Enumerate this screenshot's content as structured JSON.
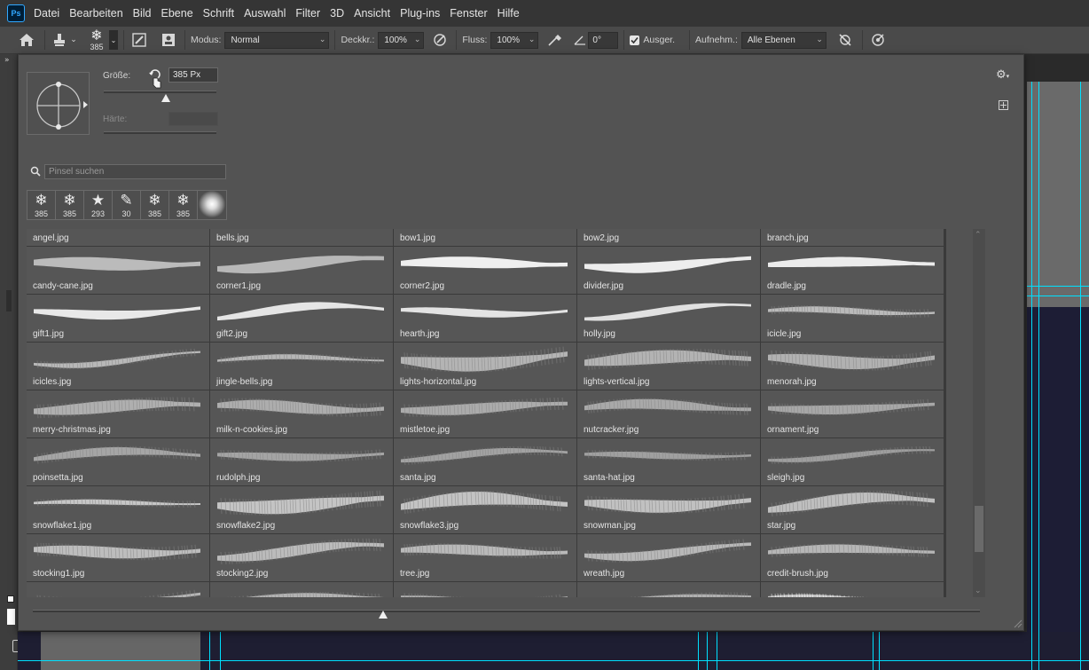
{
  "menubar": {
    "logo": "Ps",
    "items": [
      "Datei",
      "Bearbeiten",
      "Bild",
      "Ebene",
      "Schrift",
      "Auswahl",
      "Filter",
      "3D",
      "Ansicht",
      "Plug-ins",
      "Fenster",
      "Hilfe"
    ]
  },
  "optionsbar": {
    "brush_size": "385",
    "mode_label": "Modus:",
    "mode_value": "Normal",
    "opacity_label": "Deckkr.:",
    "opacity_value": "100%",
    "flow_label": "Fluss:",
    "flow_value": "100%",
    "angle_value": "0°",
    "aligned_label": "Ausger.",
    "sample_label": "Aufnehm.:",
    "sample_value": "Alle Ebenen"
  },
  "panel": {
    "size_label": "Größe:",
    "size_value": "385 Px",
    "hardness_label": "Härte:",
    "search_placeholder": "Pinsel suchen",
    "size_fraction": 0.55,
    "zoom_fraction": 0.37,
    "recent": [
      {
        "icon": "snowflake-icon",
        "glyph": "❄",
        "size": "385"
      },
      {
        "icon": "snowflake-icon",
        "glyph": "❄",
        "size": "385"
      },
      {
        "icon": "star-icon",
        "glyph": "★",
        "size": "293"
      },
      {
        "icon": "pen-brush-icon",
        "glyph": "✎",
        "size": "30"
      },
      {
        "icon": "snowflake-icon",
        "glyph": "❄",
        "size": "385"
      },
      {
        "icon": "snowflake-icon",
        "glyph": "❄",
        "size": "385"
      },
      {
        "icon": "soft-round-icon",
        "glyph": "",
        "size": ""
      }
    ],
    "header_row": [
      "angel.jpg",
      "bells.jpg",
      "bow1.jpg",
      "bow2.jpg",
      "branch.jpg"
    ],
    "brushes": [
      "candy-cane.jpg",
      "corner1.jpg",
      "corner2.jpg",
      "divider.jpg",
      "dradle.jpg",
      "gift1.jpg",
      "gift2.jpg",
      "hearth.jpg",
      "holly.jpg",
      "icicle.jpg",
      "icicles.jpg",
      "jingle-bells.jpg",
      "lights-horizontal.jpg",
      "lights-vertical.jpg",
      "menorah.jpg",
      "merry-christmas.jpg",
      "milk-n-cookies.jpg",
      "mistletoe.jpg",
      "nutcracker.jpg",
      "ornament.jpg",
      "poinsetta.jpg",
      "rudolph.jpg",
      "santa.jpg",
      "santa-hat.jpg",
      "sleigh.jpg",
      "snowflake1.jpg",
      "snowflake2.jpg",
      "snowflake3.jpg",
      "snowman.jpg",
      "star.jpg",
      "stocking1.jpg",
      "stocking2.jpg",
      "tree.jpg",
      "wreath.jpg",
      "credit-brush.jpg",
      "",
      "",
      "",
      "",
      ""
    ]
  }
}
